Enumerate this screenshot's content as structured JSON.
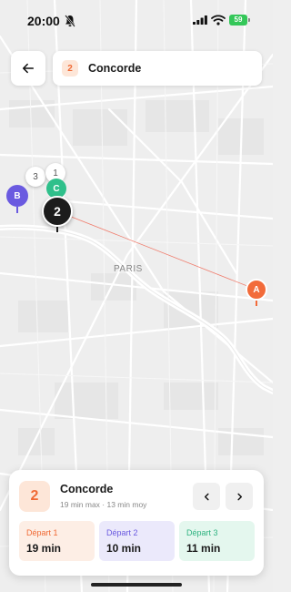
{
  "status_bar": {
    "time": "20:00",
    "battery": "59",
    "icons": [
      "bell-muted-icon",
      "signal-icon",
      "wifi-icon",
      "battery-charging-icon"
    ]
  },
  "header": {
    "back_icon": "arrow-left-icon",
    "station_number": "2",
    "station_name": "Concorde"
  },
  "map": {
    "city_label": "PARIS",
    "markers": {
      "a": "A",
      "b": "B",
      "c": "C",
      "one": "1",
      "two": "2",
      "three": "3"
    },
    "colors": {
      "a": "#f26b3a",
      "b": "#6a5ae0",
      "c": "#2fc08b",
      "selected": "#1c1c1c",
      "route_line": "#f07a6a",
      "river": "#ffffff"
    }
  },
  "card": {
    "number": "2",
    "title": "Concorde",
    "subtitle": "19 min max · 13 min moy",
    "prev_icon": "chevron-left-icon",
    "next_icon": "chevron-right-icon",
    "departures": [
      {
        "label": "Départ 1",
        "value": "19 min",
        "color": "#f06a35"
      },
      {
        "label": "Départ 2",
        "value": "10 min",
        "color": "#6a5ae0"
      },
      {
        "label": "Départ 3",
        "value": "11 min",
        "color": "#2fb380"
      }
    ]
  }
}
